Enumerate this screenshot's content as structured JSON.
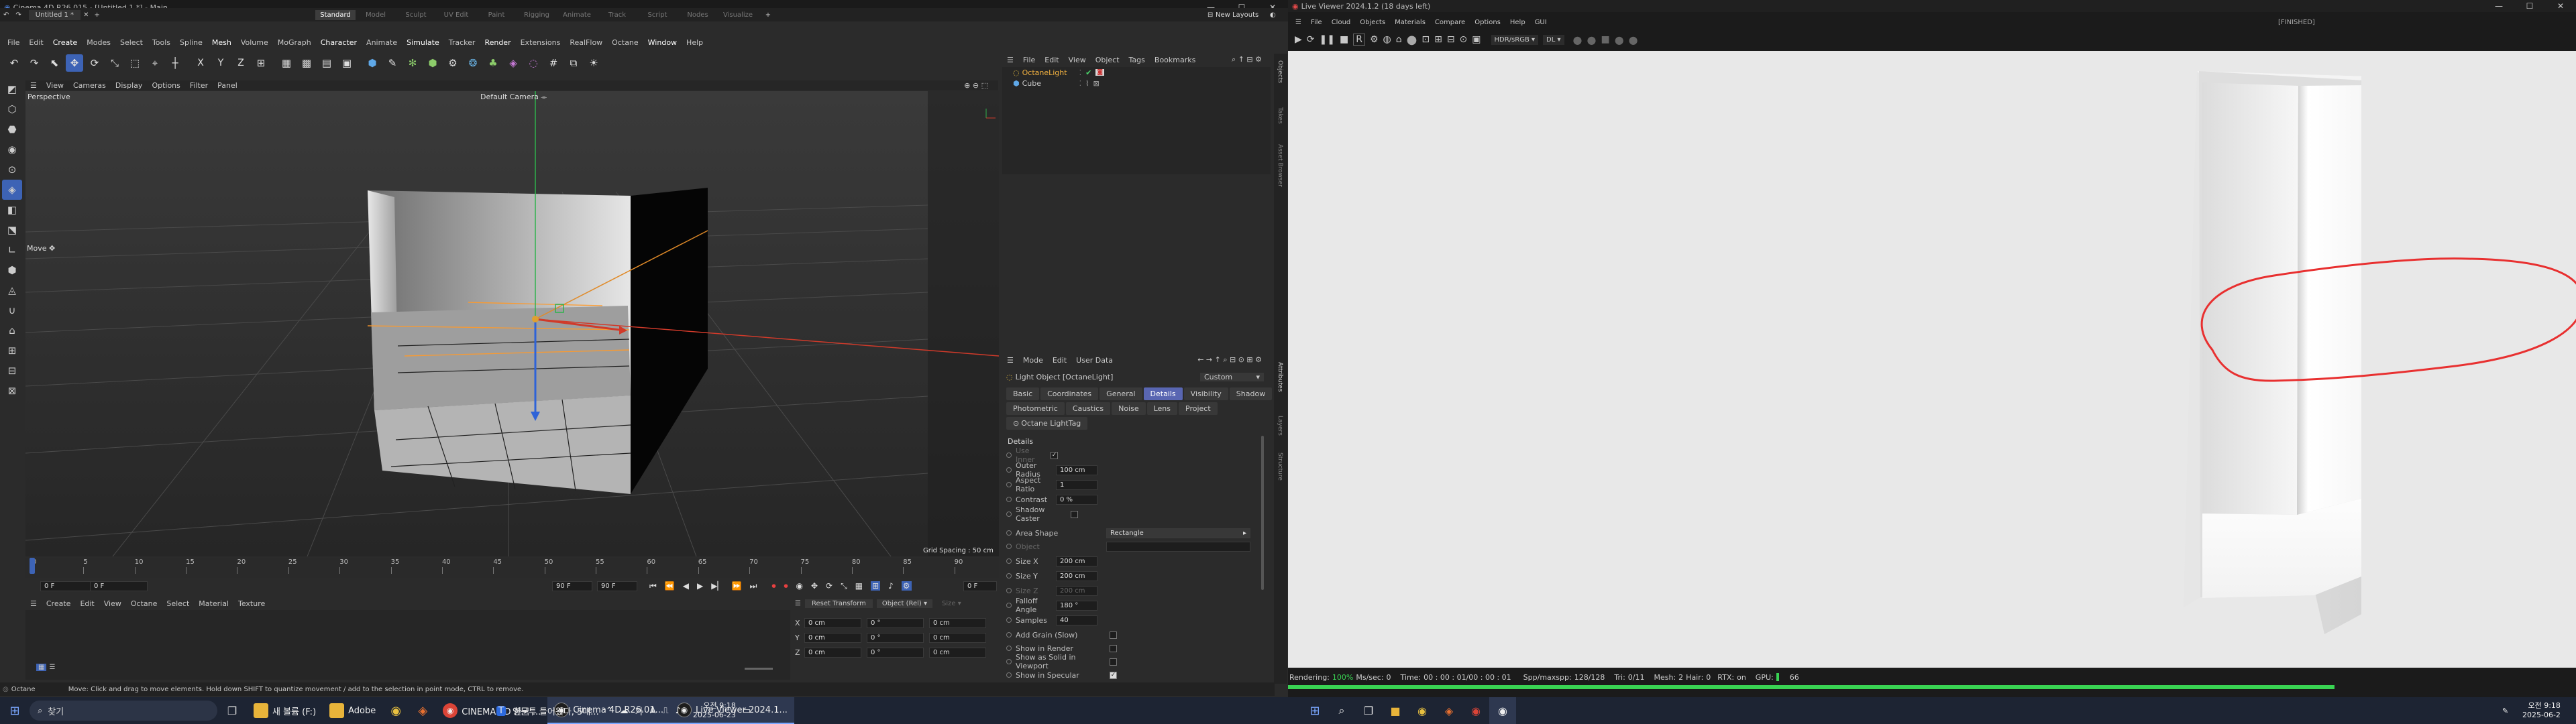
{
  "c4d": {
    "title": "Cinema 4D R26.015 - [Untitled 1 *] - Main",
    "doc_tab": "Untitled 1 *",
    "layouts": [
      "Standard",
      "Model",
      "Sculpt",
      "UV Edit",
      "Paint",
      "Rigging",
      "Animate",
      "Track",
      "Script",
      "Nodes",
      "Visualize"
    ],
    "new_layouts": "New Layouts",
    "menu": [
      "File",
      "Edit",
      "Create",
      "Modes",
      "Select",
      "Tools",
      "Spline",
      "Mesh",
      "Volume",
      "MoGraph",
      "Character",
      "Animate",
      "Simulate",
      "Tracker",
      "Render",
      "Extensions",
      "RealFlow",
      "Octane",
      "Window",
      "Help"
    ],
    "coord_labels": [
      "X",
      "Y",
      "Z"
    ],
    "viewport": {
      "menu": [
        "View",
        "Cameras",
        "Display",
        "Options",
        "Filter",
        "Panel"
      ],
      "label": "Perspective",
      "camera": "Default Camera",
      "move_label": "Move",
      "grid_spacing": "Grid Spacing : 50 cm"
    },
    "timeline": {
      "ticks": [
        "0",
        "5",
        "10",
        "15",
        "20",
        "25",
        "30",
        "35",
        "40",
        "45",
        "50",
        "55",
        "60",
        "65",
        "70",
        "75",
        "80",
        "85",
        "90"
      ],
      "current": "0 F",
      "start": "0 F",
      "start2": "0 F",
      "end": "90 F",
      "end2": "90 F"
    },
    "material_menu": [
      "Create",
      "Edit",
      "View",
      "Octane",
      "Select",
      "Material",
      "Texture"
    ],
    "coords": {
      "reset": "Reset Transform",
      "mode": "Object (Rel)",
      "size_label": "Size",
      "rows": [
        {
          "axis": "X",
          "pos": "0 cm",
          "rot": "0 °",
          "size": "0 cm"
        },
        {
          "axis": "Y",
          "pos": "0 cm",
          "rot": "0 °",
          "size": "0 cm"
        },
        {
          "axis": "Z",
          "pos": "0 cm",
          "rot": "0 °",
          "size": "0 cm"
        }
      ]
    },
    "status": {
      "app": "Octane",
      "message": "Move: Click and drag to move elements. Hold down SHIFT to quantize movement / add to the selection in point mode, CTRL to remove."
    },
    "object_manager": {
      "menu": [
        "File",
        "Edit",
        "View",
        "Object",
        "Tags",
        "Bookmarks"
      ],
      "objects": [
        "OctaneLight",
        "Cube"
      ]
    },
    "attributes": {
      "menu": [
        "Mode",
        "Edit",
        "User Data"
      ],
      "object_title": "Light Object [OctaneLight]",
      "preset": "Custom",
      "tabs_row1": [
        "Basic",
        "Coordinates",
        "General",
        "Details",
        "Visibility",
        "Shadow"
      ],
      "tabs_row2": [
        "Photometric",
        "Caustics",
        "Noise",
        "Lens",
        "Project"
      ],
      "tag_tab": "Octane LightTag",
      "active_tab": "Details",
      "section": "Details",
      "use_inner": "Use Inner",
      "outer_radius": {
        "label": "Outer Radius",
        "value": "100 cm"
      },
      "aspect_ratio": {
        "label": "Aspect Ratio",
        "value": "1"
      },
      "contrast": {
        "label": "Contrast",
        "value": "0 %"
      },
      "shadow_caster": "Shadow Caster",
      "area_shape": {
        "label": "Area Shape",
        "value": "Rectangle"
      },
      "object": "Object",
      "size_x": {
        "label": "Size X",
        "value": "200 cm"
      },
      "size_y": {
        "label": "Size Y",
        "value": "200 cm"
      },
      "size_z": {
        "label": "Size Z",
        "value": "200 cm"
      },
      "falloff_angle": {
        "label": "Falloff Angle",
        "value": "180 °"
      },
      "samples": {
        "label": "Samples",
        "value": "40"
      },
      "add_grain": "Add Grain (Slow)",
      "show_in_render": "Show in Render",
      "show_solid": "Show as Solid in Viewport",
      "show_specular": "Show in Specular"
    },
    "side_tabs": [
      "Objects",
      "Takes",
      "Asset Browser",
      "Attributes",
      "Layers",
      "Structure"
    ]
  },
  "octane": {
    "title": "Live Viewer 2024.1.2 (18 days left)",
    "menu": [
      "File",
      "Cloud",
      "Objects",
      "Materials",
      "Compare",
      "Options",
      "Help",
      "GUI"
    ],
    "finished": "[FINISHED]",
    "color_mode": "HDR/sRGB",
    "kernel": "DL",
    "status": {
      "rendering_label": "Rendering:",
      "rendering": "100%",
      "mssec_label": "Ms/sec:",
      "mssec": "0",
      "time_label": "Time:",
      "time": "00 : 00 : 01/00 : 00 : 01",
      "spp_label": "Spp/maxspp:",
      "spp": "128/128",
      "tri_label": "Tri:",
      "tri": "0/11",
      "mesh_label": "Mesh:",
      "mesh": "2",
      "hair_label": "Hair:",
      "hair": "0",
      "rtx_label": "RTX:",
      "rtx": "on",
      "gpu_label": "GPU:",
      "gpu": "66"
    }
  },
  "taskbar_left": {
    "search": "찾기",
    "apps": [
      "새 볼륨 (F:)",
      "Adobe",
      "CINEMA 4D 한국 ...",
      "Cinema 4D R26.01...",
      "Live Viewer 2024.1..."
    ],
    "tray_text": "영문투 들어왔다, 5대...",
    "ime": "가",
    "lang": "A",
    "time": "오전 9:18",
    "date": "2025-06-23"
  },
  "taskbar_right": {
    "time": "오전 9:18",
    "date": "2025-06-2"
  },
  "colors": {
    "accent": "#5966b2",
    "octane_red": "#e83030",
    "status_green": "#39d353"
  }
}
